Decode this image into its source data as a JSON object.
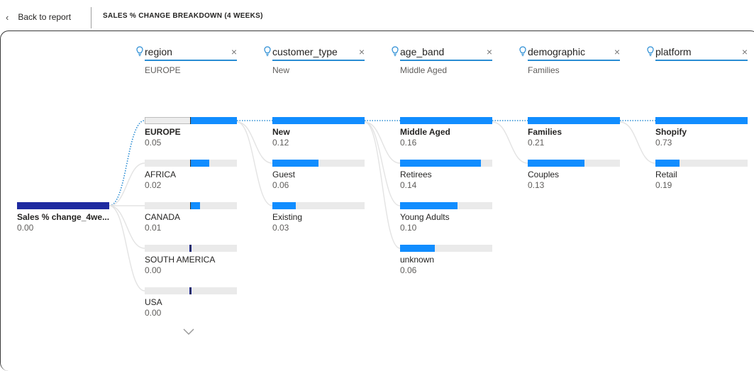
{
  "header": {
    "back_label": "Back to report",
    "title": "SALES % CHANGE BREAKDOWN (4 WEEKS)"
  },
  "root": {
    "label": "Sales % change_4we...",
    "value": "0.00"
  },
  "levels": [
    {
      "name": "region",
      "selected": "EUROPE"
    },
    {
      "name": "customer_type",
      "selected": "New"
    },
    {
      "name": "age_band",
      "selected": "Middle Aged"
    },
    {
      "name": "demographic",
      "selected": "Families"
    },
    {
      "name": "platform",
      "selected": ""
    }
  ],
  "nodes": [
    [
      {
        "label": "EUROPE",
        "value": "0.05"
      },
      {
        "label": "AFRICA",
        "value": "0.02"
      },
      {
        "label": "CANADA",
        "value": "0.01"
      },
      {
        "label": "SOUTH AMERICA",
        "value": "0.00"
      },
      {
        "label": "USA",
        "value": "0.00"
      }
    ],
    [
      {
        "label": "New",
        "value": "0.12"
      },
      {
        "label": "Guest",
        "value": "0.06"
      },
      {
        "label": "Existing",
        "value": "0.03"
      }
    ],
    [
      {
        "label": "Middle Aged",
        "value": "0.16"
      },
      {
        "label": "Retirees",
        "value": "0.14"
      },
      {
        "label": "Young Adults",
        "value": "0.10"
      },
      {
        "label": "unknown",
        "value": "0.06"
      }
    ],
    [
      {
        "label": "Families",
        "value": "0.21"
      },
      {
        "label": "Couples",
        "value": "0.13"
      }
    ],
    [
      {
        "label": "Shopify",
        "value": "0.73"
      },
      {
        "label": "Retail",
        "value": "0.19"
      }
    ]
  ],
  "colors": {
    "bar_positive": "#118dff",
    "bar_negative": "#1e2aa0",
    "track": "#eaeaea",
    "accent_line": "#2a8dd4"
  },
  "icons": {
    "back": "chevron-left-icon",
    "level": "lightbulb-icon",
    "remove": "close-icon",
    "more": "chevron-down-icon"
  }
}
